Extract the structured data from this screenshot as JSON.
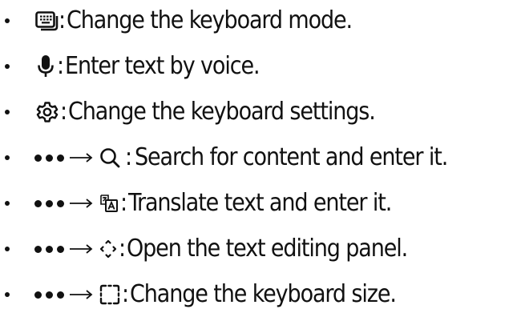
{
  "items": [
    {
      "icon": "keyboard-mode-icon",
      "has_more_prefix": false,
      "separator": ":",
      "text": "Change the keyboard mode."
    },
    {
      "icon": "microphone-icon",
      "has_more_prefix": false,
      "separator": ":",
      "text": "Enter text by voice."
    },
    {
      "icon": "gear-icon",
      "has_more_prefix": false,
      "separator": ":",
      "text": "Change the keyboard settings."
    },
    {
      "icon": "search-icon",
      "has_more_prefix": true,
      "separator": ":",
      "text": "Search for content and enter it."
    },
    {
      "icon": "translate-icon",
      "has_more_prefix": true,
      "separator": ":",
      "text": "Translate text and enter it."
    },
    {
      "icon": "text-edit-panel-icon",
      "has_more_prefix": true,
      "separator": ":",
      "text": "Open the text editing panel."
    },
    {
      "icon": "keyboard-size-icon",
      "has_more_prefix": true,
      "separator": ":",
      "text": "Change the keyboard size."
    }
  ]
}
